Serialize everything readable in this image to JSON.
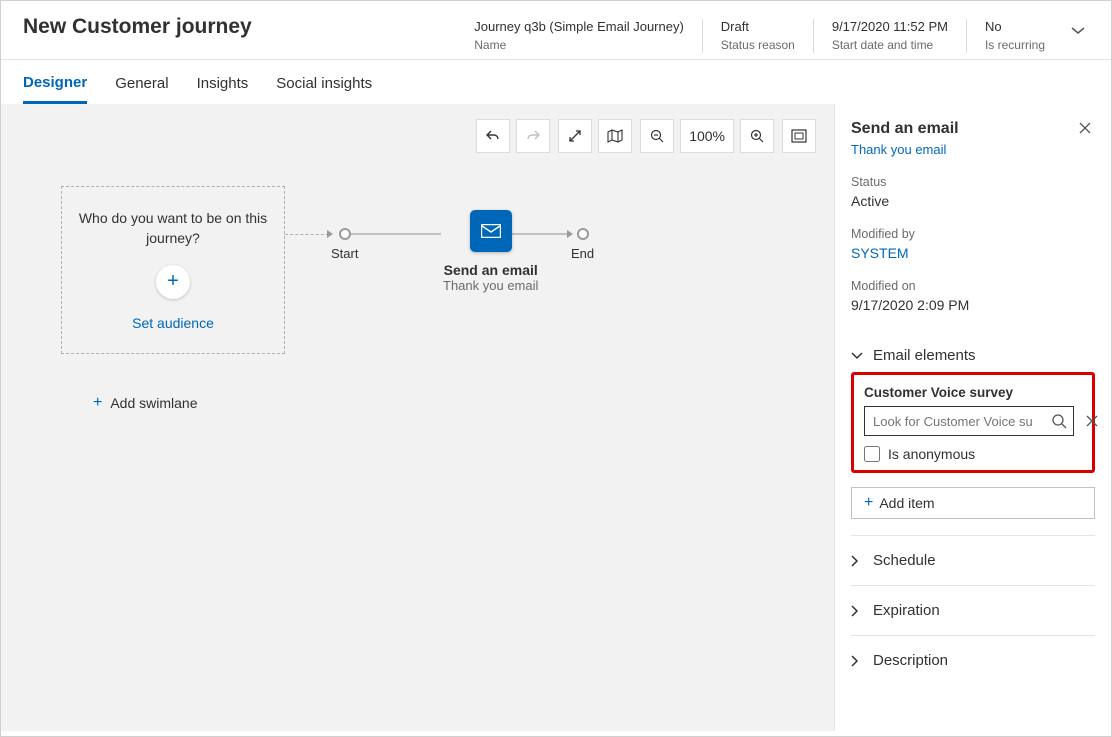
{
  "header": {
    "title": "New Customer journey",
    "name_value": "Journey q3b (Simple Email Journey)",
    "name_label": "Name",
    "status_value": "Draft",
    "status_label": "Status reason",
    "start_value": "9/17/2020 11:52 PM",
    "start_label": "Start date and time",
    "recur_value": "No",
    "recur_label": "Is recurring"
  },
  "tabs": {
    "designer": "Designer",
    "general": "General",
    "insights": "Insights",
    "social": "Social insights"
  },
  "toolbar": {
    "zoom": "100%"
  },
  "canvas": {
    "audience_q": "Who do you want to be on this journey?",
    "set_audience": "Set audience",
    "start": "Start",
    "end": "End",
    "email_title": "Send an email",
    "email_sub": "Thank you email",
    "add_swimlane": "Add swimlane"
  },
  "panel": {
    "title": "Send an email",
    "link": "Thank you email",
    "status_label": "Status",
    "status_value": "Active",
    "modby_label": "Modified by",
    "modby_value": "SYSTEM",
    "modon_label": "Modified on",
    "modon_value": "9/17/2020 2:09 PM",
    "elements": "Email elements",
    "survey_label": "Customer Voice survey",
    "survey_placeholder": "Look for Customer Voice su",
    "anon": "Is anonymous",
    "add_item": "Add item",
    "schedule": "Schedule",
    "expiration": "Expiration",
    "description": "Description"
  }
}
